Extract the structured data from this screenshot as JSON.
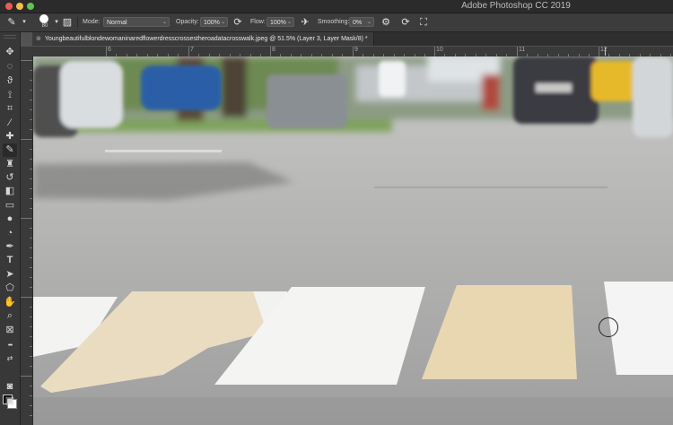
{
  "window": {
    "title": "Adobe Photoshop CC 2019"
  },
  "options_bar": {
    "brush_size": "80",
    "mode_label": "Mode:",
    "mode_value": "Normal",
    "opacity_label": "Opacity:",
    "opacity_value": "100%",
    "flow_label": "Flow:",
    "flow_value": "100%",
    "smoothing_label": "Smoothing:",
    "smoothing_value": "0%"
  },
  "document": {
    "tab_title": "Youngbeautifulblondewomaninaredflowerdresscrossestheroadatacrosswalk.jpeg @ 51.5% (Layer 3, Layer Mask/8) *"
  },
  "ruler": {
    "h_labels": [
      "6",
      "7",
      "8",
      "9",
      "10",
      "11",
      "12"
    ]
  },
  "tools": [
    {
      "icon": "move-icon",
      "glyph": "✥"
    },
    {
      "icon": "marquee-icon",
      "glyph": "◌"
    },
    {
      "icon": "lasso-icon",
      "glyph": "ϑ"
    },
    {
      "icon": "quick-select-icon",
      "glyph": "⟟"
    },
    {
      "icon": "crop-icon",
      "glyph": "⌗"
    },
    {
      "icon": "eyedropper-icon",
      "glyph": "⁄"
    },
    {
      "icon": "healing-icon",
      "glyph": "✚"
    },
    {
      "icon": "brush-icon",
      "glyph": "✎"
    },
    {
      "icon": "stamp-icon",
      "glyph": "♜"
    },
    {
      "icon": "history-brush-icon",
      "glyph": "↺"
    },
    {
      "icon": "eraser-icon",
      "glyph": "◧"
    },
    {
      "icon": "gradient-icon",
      "glyph": "▭"
    },
    {
      "icon": "blur-icon",
      "glyph": "●"
    },
    {
      "icon": "dodge-icon",
      "glyph": "◔"
    },
    {
      "icon": "pen-icon",
      "glyph": "✒"
    },
    {
      "icon": "type-icon",
      "glyph": "T"
    },
    {
      "icon": "path-select-icon",
      "glyph": "➤"
    },
    {
      "icon": "shape-icon",
      "glyph": "⬠"
    },
    {
      "icon": "hand-icon",
      "glyph": "✋"
    },
    {
      "icon": "zoom-icon",
      "glyph": "⌕"
    },
    {
      "icon": "frame-icon",
      "glyph": "⊠"
    },
    {
      "icon": "more-tools-icon",
      "glyph": "•••"
    }
  ],
  "colors": {
    "foreground": "#000000",
    "background": "#ffffff"
  }
}
